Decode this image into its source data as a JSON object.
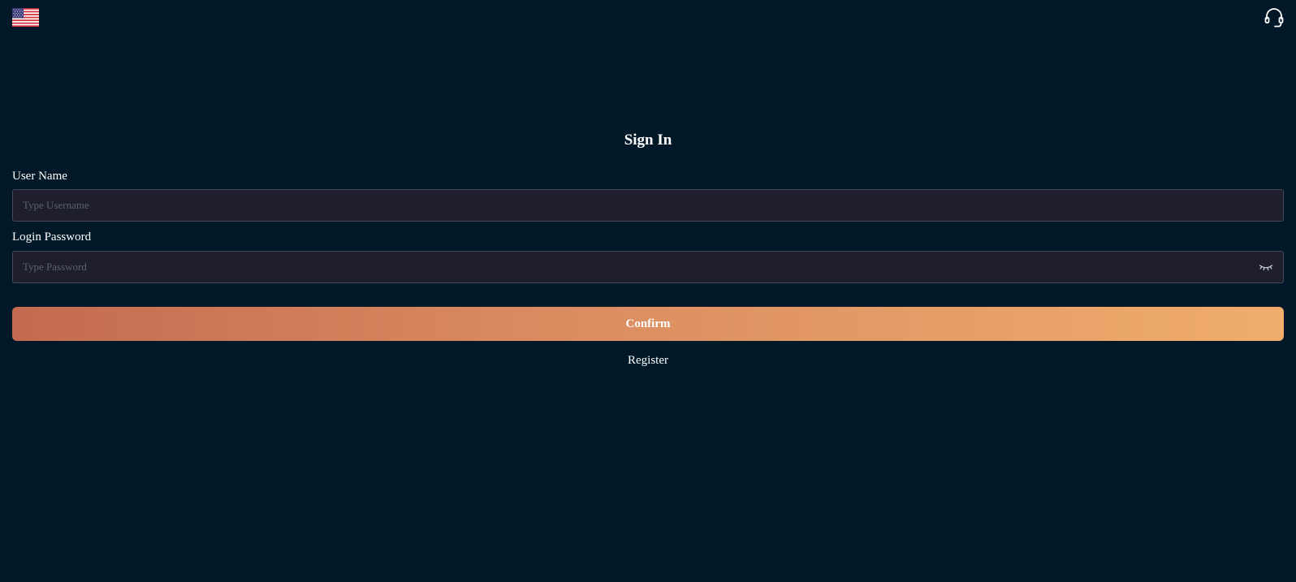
{
  "header": {
    "language_icon": "us-flag-icon",
    "support_icon": "headset-icon"
  },
  "form": {
    "title": "Sign In",
    "username": {
      "label": "User Name",
      "value": "",
      "placeholder": "Type Username"
    },
    "password": {
      "label": "Login Password",
      "value": "",
      "placeholder": "Type Password",
      "toggle_icon": "eye-closed-icon"
    },
    "confirm_label": "Confirm",
    "register_label": "Register"
  },
  "colors": {
    "background": "#001827",
    "input_background": "#1e1e2d",
    "input_border": "#45495a",
    "button_gradient_start": "#c46a50",
    "button_gradient_end": "#f0ad6c",
    "text": "#ffffff",
    "placeholder": "#5c6070"
  }
}
